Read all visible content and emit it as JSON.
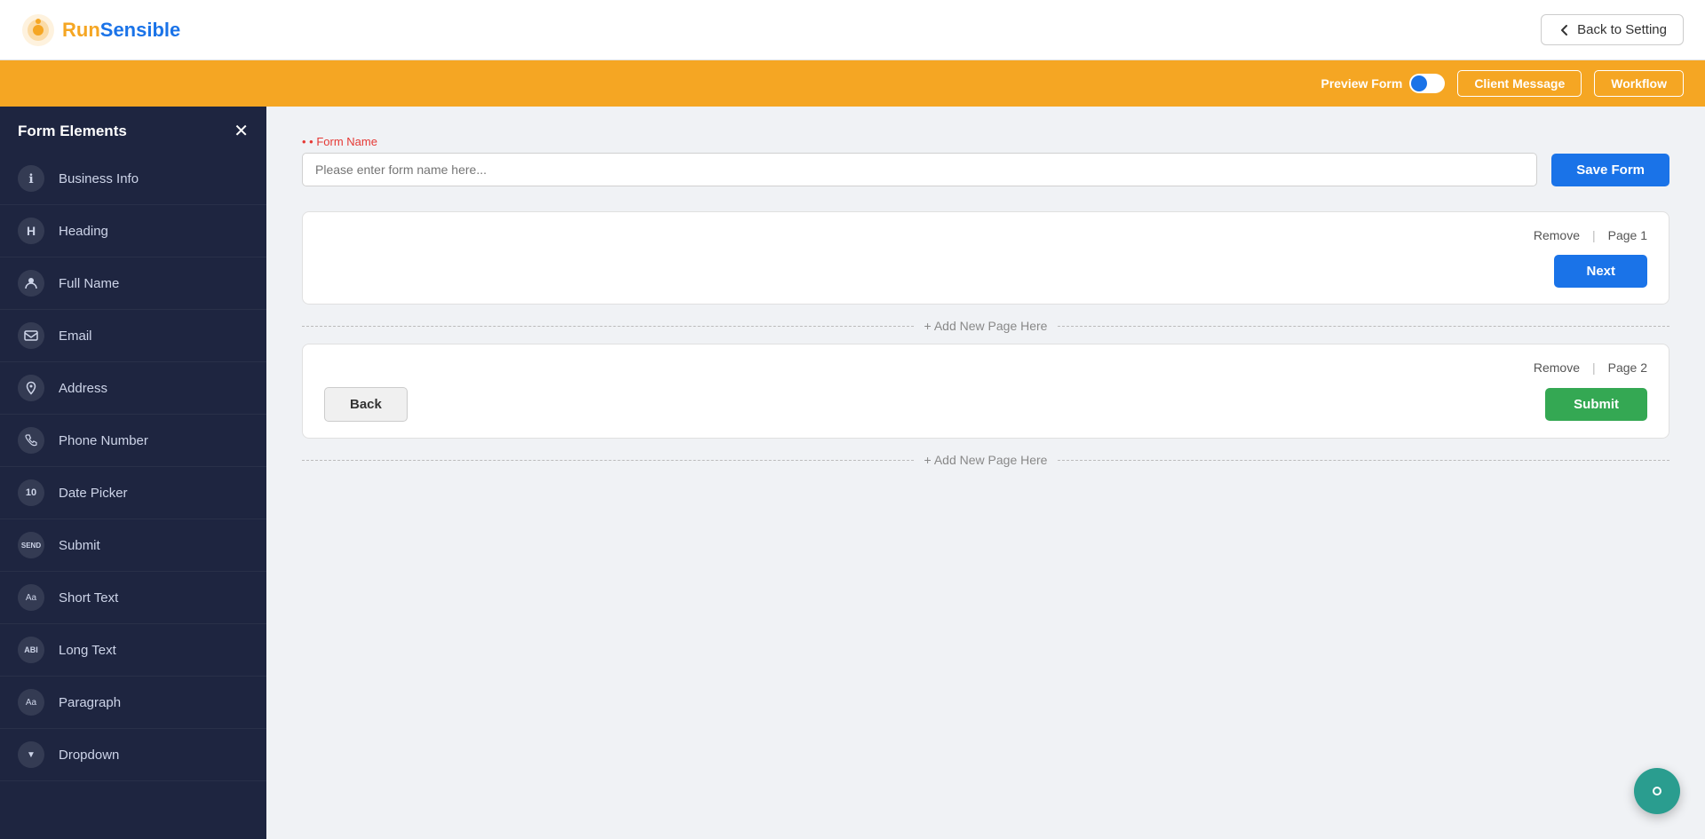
{
  "header": {
    "logo_run": "Run",
    "logo_sensible": "Sensible",
    "back_to_setting_label": "Back to Setting"
  },
  "banner": {
    "preview_form_label": "Preview Form",
    "client_message_label": "Client Message",
    "workflow_label": "Workflow"
  },
  "sidebar": {
    "title": "Form Elements",
    "close_icon": "✕",
    "items": [
      {
        "label": "Business Info",
        "icon": "ℹ"
      },
      {
        "label": "Heading",
        "icon": "H"
      },
      {
        "label": "Full Name",
        "icon": "👤"
      },
      {
        "label": "Email",
        "icon": "✉"
      },
      {
        "label": "Address",
        "icon": "📍"
      },
      {
        "label": "Phone Number",
        "icon": "📞"
      },
      {
        "label": "Date Picker",
        "icon": "📅"
      },
      {
        "label": "Submit",
        "icon": "✉"
      },
      {
        "label": "Short Text",
        "icon": "Aa"
      },
      {
        "label": "Long Text",
        "icon": "AB"
      },
      {
        "label": "Paragraph",
        "icon": "Aa"
      },
      {
        "label": "Dropdown",
        "icon": "▼"
      }
    ]
  },
  "form_name": {
    "label": "• Form Name",
    "placeholder": "Please enter form name here...",
    "save_label": "Save Form"
  },
  "pages": [
    {
      "remove_label": "Remove",
      "page_label": "Page 1",
      "action_label": "Next"
    },
    {
      "remove_label": "Remove",
      "page_label": "Page 2",
      "back_label": "Back",
      "submit_label": "Submit"
    }
  ],
  "add_page_label": "+ Add New Page Here",
  "colors": {
    "accent_blue": "#1a73e8",
    "accent_orange": "#f5a623",
    "accent_green": "#34a853",
    "sidebar_bg": "#1e2540",
    "dark_circle": "#1a1a2e"
  }
}
